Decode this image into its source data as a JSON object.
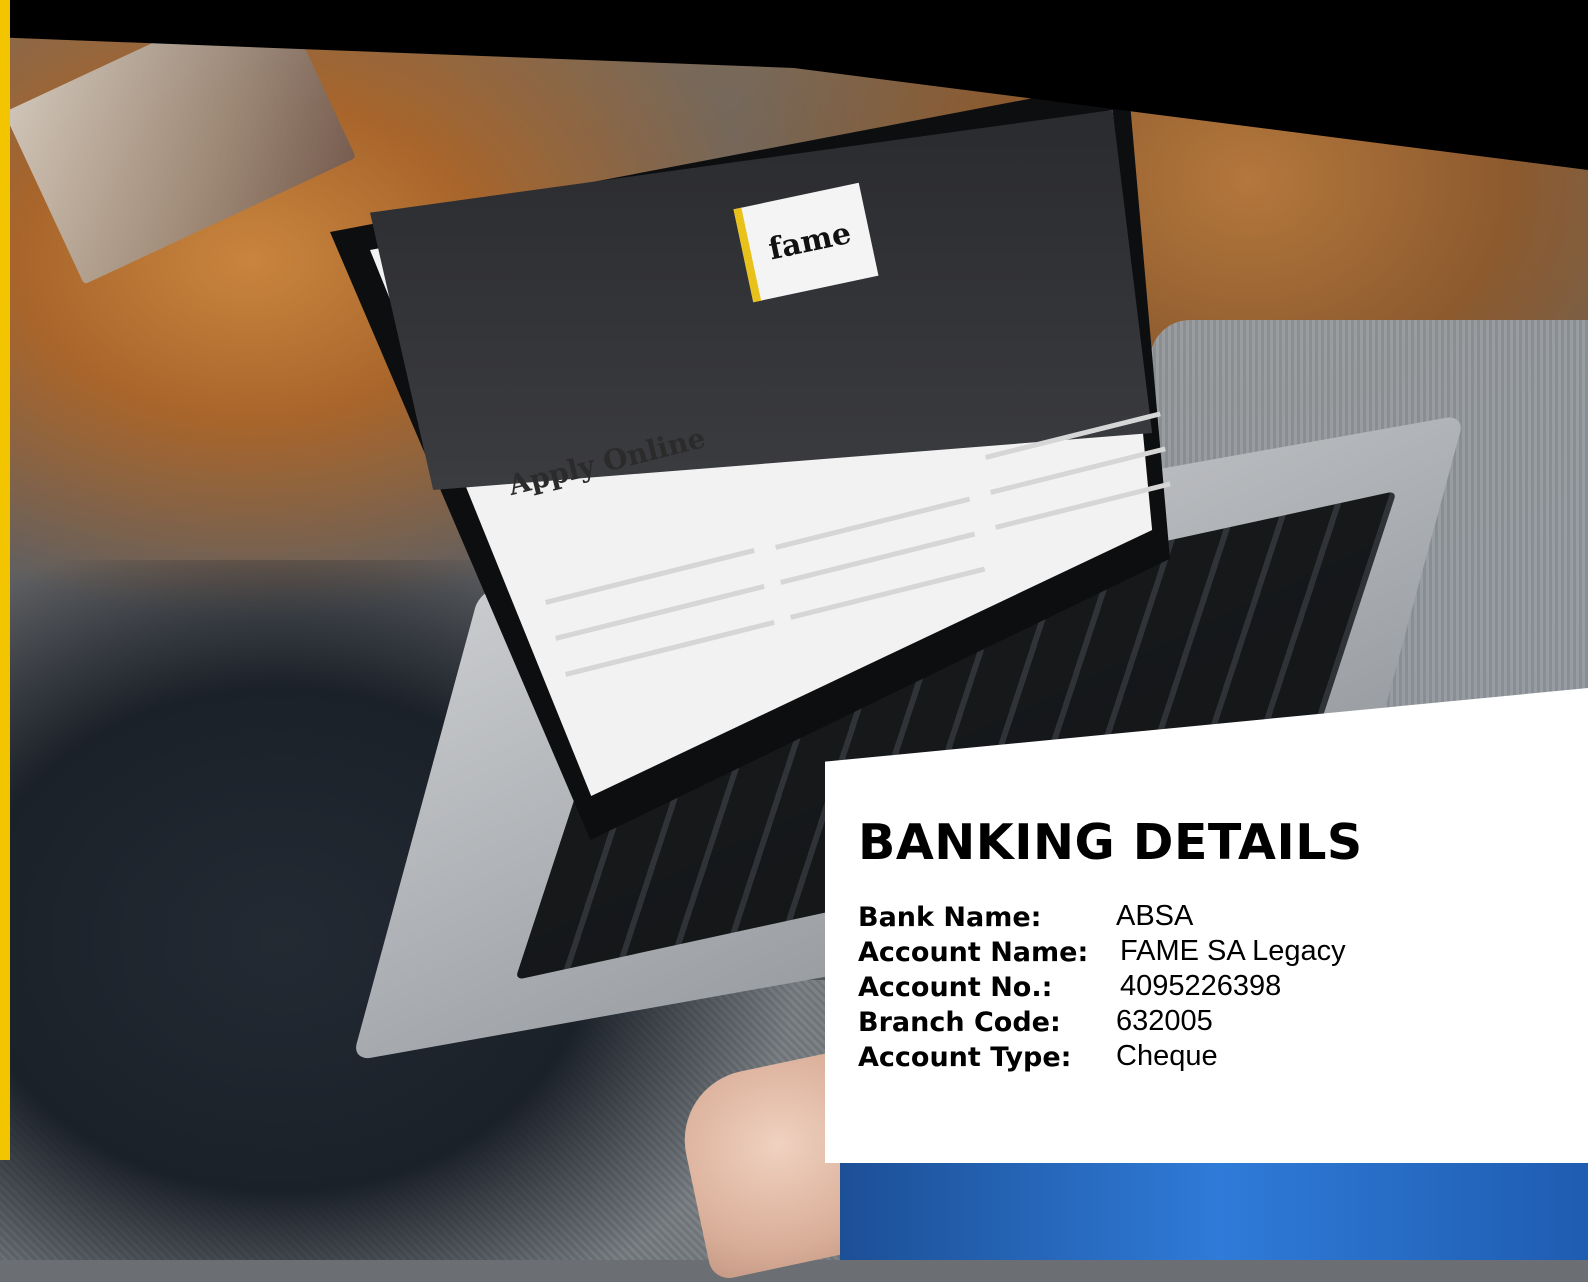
{
  "screen": {
    "logo_text": "fame",
    "heading": "Apply Online"
  },
  "banking": {
    "title": "BANKING DETAILS",
    "rows": [
      {
        "label": "Bank Name:",
        "value": "ABSA"
      },
      {
        "label": "Account Name:",
        "value": "FAME SA Legacy"
      },
      {
        "label": "Account No.:",
        "value": "4095226398"
      },
      {
        "label": "Branch Code:",
        "value": "632005"
      },
      {
        "label": "Account Type:",
        "value": "Cheque"
      }
    ]
  },
  "colors": {
    "accent_yellow": "#f2c500",
    "band_black": "#000000",
    "panel_white": "#ffffff"
  }
}
